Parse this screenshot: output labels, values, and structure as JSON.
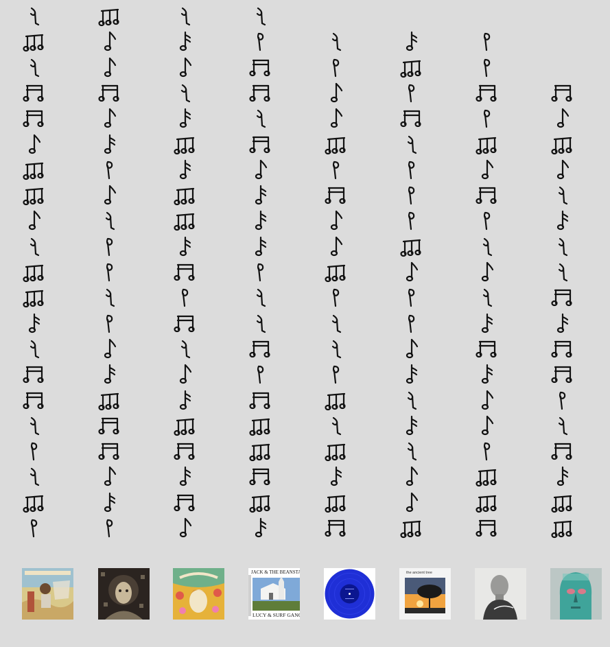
{
  "notes": {
    "grid": [
      [
        "q",
        "b3",
        "q",
        "q"
      ],
      [
        "b3",
        "e",
        "s",
        "h",
        "q",
        "s",
        "h"
      ],
      [
        "q",
        "e",
        "e",
        "b4",
        "h",
        "b3",
        "h"
      ],
      [
        "b4",
        "b4",
        "q",
        "b4",
        "e",
        "h",
        "b4",
        "b4"
      ],
      [
        "b4",
        "e",
        "s",
        "q",
        "e",
        "b4",
        "h",
        "e"
      ],
      [
        "e",
        "s",
        "b3",
        "b4",
        "b3",
        "q",
        "b3",
        "b3"
      ],
      [
        "b3",
        "h",
        "s",
        "e",
        "h",
        "h",
        "e",
        "e"
      ],
      [
        "b3",
        "e",
        "b3",
        "s",
        "b4",
        "h",
        "b4",
        "q"
      ],
      [
        "e",
        "q",
        "b3",
        "s",
        "e",
        "h",
        "h",
        "s"
      ],
      [
        "q",
        "h",
        "s",
        "s",
        "e",
        "b3",
        "q",
        "q"
      ],
      [
        "b3",
        "h",
        "b4",
        "h",
        "b3",
        "e",
        "e",
        "q"
      ],
      [
        "b3",
        "q",
        "h",
        "q",
        "h",
        "h",
        "q",
        "b4"
      ],
      [
        "s",
        "h",
        "b4",
        "q",
        "q",
        "h",
        "s",
        "s"
      ],
      [
        "q",
        "e",
        "q",
        "b4",
        "q",
        "e",
        "b4",
        "b4"
      ],
      [
        "b4",
        "s",
        "e",
        "h",
        "h",
        "s",
        "s",
        "b4"
      ],
      [
        "b4",
        "b3",
        "s",
        "b4",
        "b3",
        "q",
        "e",
        "h"
      ],
      [
        "q",
        "b4",
        "b3",
        "b3",
        "q",
        "s",
        "e",
        "q"
      ],
      [
        "h",
        "b4",
        "b4",
        "b3",
        "b3",
        "q",
        "h",
        "b4"
      ],
      [
        "q",
        "e",
        "s",
        "b4",
        "s",
        "e",
        "b3",
        "s"
      ],
      [
        "b3",
        "s",
        "b4",
        "b3",
        "b3",
        "e",
        "b3",
        "b3"
      ],
      [
        "h",
        "h",
        "e",
        "s",
        "b4",
        "b3",
        "b4",
        "b3"
      ]
    ],
    "glyph_names": {
      "q": "q-note-icon",
      "h": "p-note-icon",
      "e": "eighth-note-icon",
      "s": "grace-note-icon",
      "b3": "triplet-beamed-notes-icon",
      "b4": "sixteenth-beamed-notes-icon"
    }
  },
  "albums": [
    {
      "icon": "album-cover-desert-rider-icon",
      "text": "",
      "colors": [
        "#d9c98a",
        "#8fb3c4",
        "#b0533a"
      ]
    },
    {
      "icon": "album-cover-mosaic-portrait-icon",
      "text": "",
      "colors": [
        "#2b2420",
        "#7a6e5a",
        "#c8b89a"
      ]
    },
    {
      "icon": "album-cover-sun-flowers-icon",
      "text": "",
      "colors": [
        "#e6b23a",
        "#6fb08a",
        "#f2e6c8"
      ]
    },
    {
      "icon": "album-cover-chapel-icon",
      "text_top": "JACK & THE BEANSTALK",
      "text_bottom": "LUCY & SURF GANG",
      "colors": [
        "#ffffff",
        "#7fa9d8",
        "#5f7d3a"
      ]
    },
    {
      "icon": "album-cover-blue-vinyl-icon",
      "text": "",
      "colors": [
        "#1f2fd6",
        "#4a5cf0",
        "#0b1690"
      ]
    },
    {
      "icon": "album-cover-tree-sunset-icon",
      "text": "the ancient tree",
      "colors": [
        "#f4f4f4",
        "#f0a340",
        "#2a2a2a"
      ]
    },
    {
      "icon": "album-cover-bald-man-icon",
      "text": "",
      "colors": [
        "#e8e8e6",
        "#9a9a98",
        "#3a3a3a"
      ]
    },
    {
      "icon": "album-cover-statue-head-icon",
      "text": "",
      "colors": [
        "#3fa49a",
        "#d87a8a",
        "#2a6a66"
      ]
    }
  ]
}
